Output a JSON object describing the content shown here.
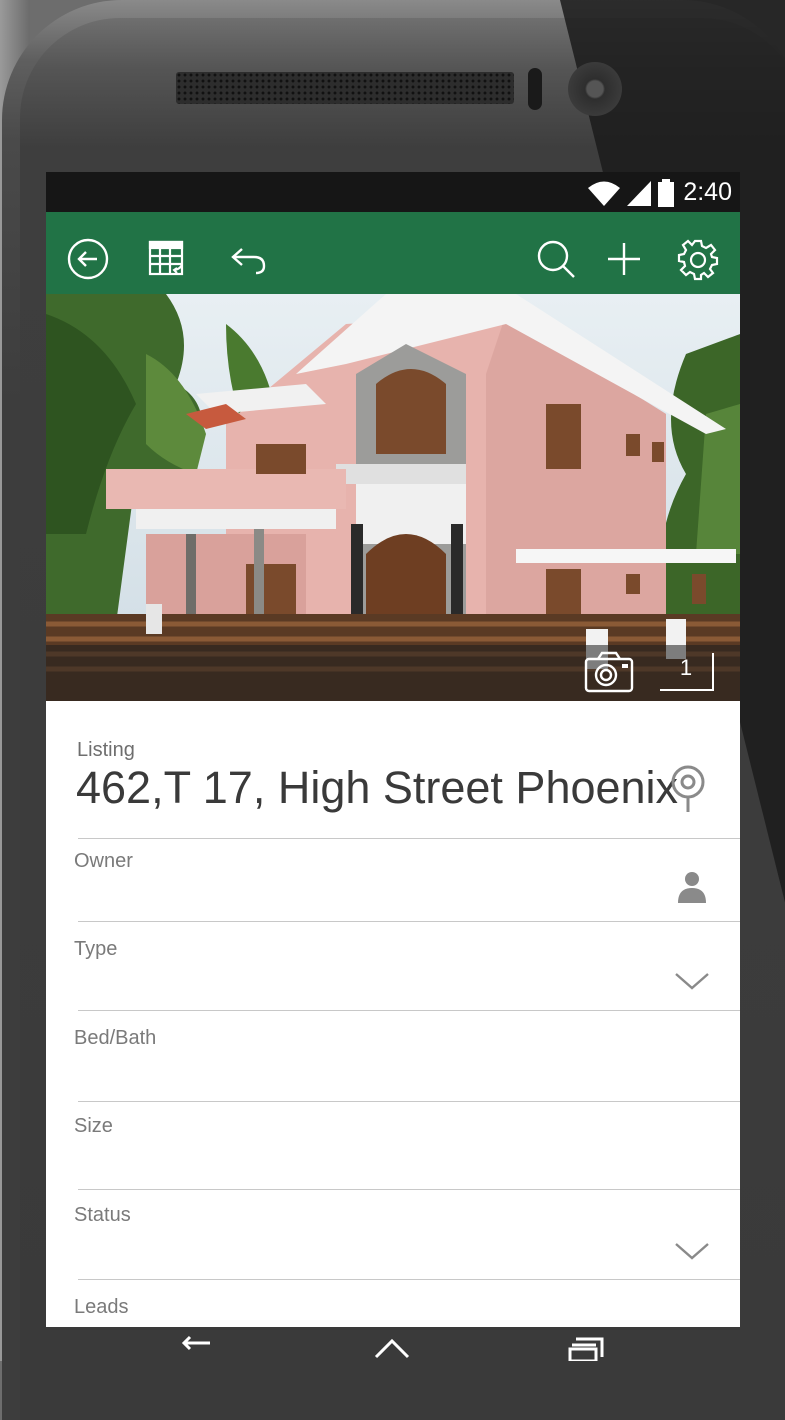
{
  "status_bar": {
    "time": "2:40"
  },
  "colors": {
    "app_bar": "#217346",
    "label": "#7a7a7a",
    "title": "#3a3a3a"
  },
  "app_bar": {
    "icons": [
      "back-circle-icon",
      "sheet-icon",
      "undo-icon",
      "search-icon",
      "add-icon",
      "settings-icon"
    ]
  },
  "photo": {
    "count": "1"
  },
  "listing": {
    "label": "Listing",
    "title": "462,T 17, High Street Phoenix"
  },
  "fields": [
    {
      "label": "Owner",
      "icon": "person-icon"
    },
    {
      "label": "Type",
      "icon": "chevron-down-icon"
    },
    {
      "label": "Bed/Bath",
      "icon": ""
    },
    {
      "label": "Size",
      "icon": ""
    },
    {
      "label": "Status",
      "icon": "chevron-down-icon"
    },
    {
      "label": "Leads",
      "icon": ""
    }
  ],
  "nav": {
    "icons": [
      "back-icon",
      "home-icon",
      "recents-icon"
    ]
  }
}
